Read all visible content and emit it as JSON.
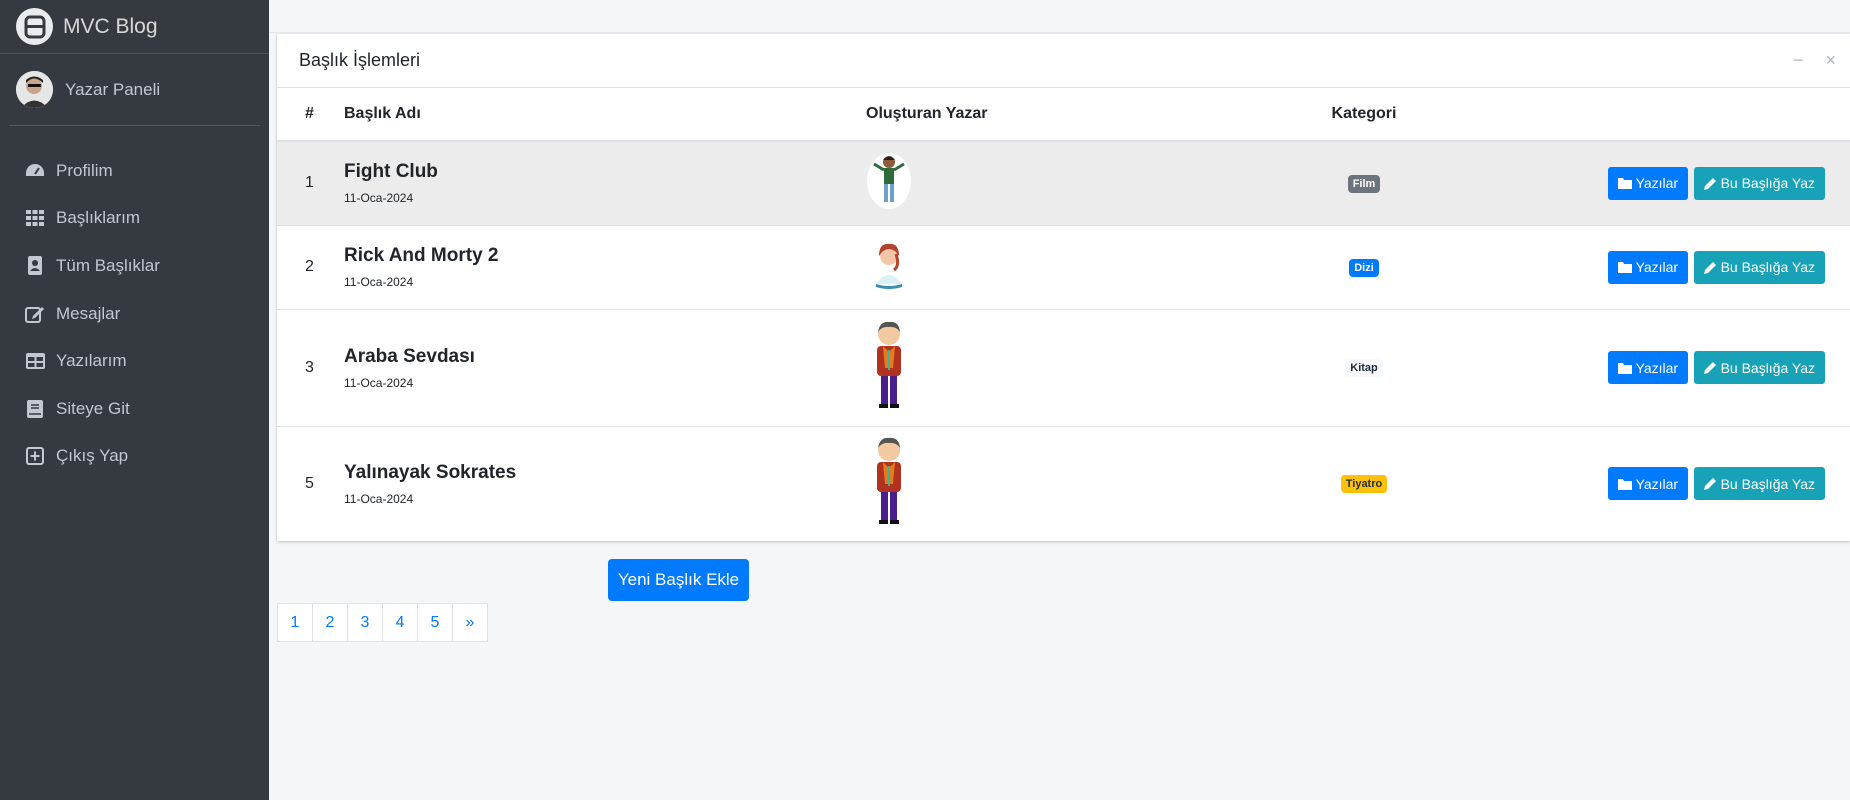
{
  "sidebar": {
    "brand": "MVC Blog",
    "user": "Yazar Paneli",
    "items": [
      {
        "label": "Profilim",
        "icon": "tachometer-icon"
      },
      {
        "label": "Başlıklarım",
        "icon": "grid-icon"
      },
      {
        "label": "Tüm Başlıklar",
        "icon": "address-book-icon"
      },
      {
        "label": "Mesajlar",
        "icon": "edit-icon"
      },
      {
        "label": "Yazılarım",
        "icon": "table-icon"
      },
      {
        "label": "Siteye Git",
        "icon": "book-icon"
      },
      {
        "label": "Çıkış Yap",
        "icon": "plus-square-icon"
      }
    ]
  },
  "card": {
    "title": "Başlık İşlemleri",
    "tools": {
      "minimize": "−",
      "close": "×"
    }
  },
  "table": {
    "headers": [
      "#",
      "Başlık Adı",
      "Oluşturan Yazar",
      "Kategori",
      ""
    ],
    "rows": [
      {
        "num": "1",
        "title": "Fight Club",
        "date": "11-Oca-2024",
        "author_icon": "boy-avatar-icon",
        "category": "Film",
        "category_color": "#6c757d",
        "category_text_color": "#ffffff"
      },
      {
        "num": "2",
        "title": "Rick And Morty 2",
        "date": "11-Oca-2024",
        "author_icon": "woman-avatar-icon",
        "category": "Dizi",
        "category_color": "#007bff",
        "category_text_color": "#ffffff"
      },
      {
        "num": "3",
        "title": "Araba Sevdası",
        "date": "11-Oca-2024",
        "author_icon": "man-avatar-icon",
        "category": "Kitap",
        "category_color": "#f8f9fa",
        "category_text_color": "#1f2d3d"
      },
      {
        "num": "5",
        "title": "Yalınayak Sokrates",
        "date": "11-Oca-2024",
        "author_icon": "man-avatar-icon",
        "category": "Tiyatro",
        "category_color": "#ffc107",
        "category_text_color": "#1f2d3d"
      }
    ],
    "actions": {
      "posts_label": "Yazılar",
      "write_label": "Bu Başlığa Yaz"
    }
  },
  "add_button": "Yeni Başlık Ekle",
  "pagination": [
    "1",
    "2",
    "3",
    "4",
    "5",
    "»"
  ],
  "colors": {
    "sidebar": "#343a40",
    "primary": "#007bff",
    "info": "#17a2b8",
    "background": "#f4f6f9"
  }
}
